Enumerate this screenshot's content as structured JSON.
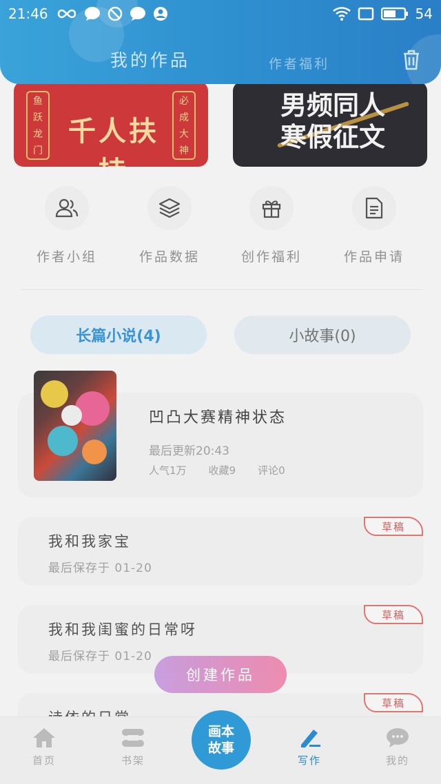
{
  "status_bar": {
    "time": "21:46",
    "battery": "54"
  },
  "header": {
    "tab_mine": "我的作品",
    "tab_welfare": "作者福利"
  },
  "banners": {
    "left": {
      "text": "千人扶持",
      "side_left": [
        "鱼",
        "跃",
        "龙",
        "门"
      ],
      "side_right": [
        "必",
        "成",
        "大",
        "神"
      ]
    },
    "right": {
      "line1": "男频同人",
      "line2": "寒假征文"
    }
  },
  "quick_actions": [
    {
      "label": "作者小组",
      "icon": "users-icon"
    },
    {
      "label": "作品数据",
      "icon": "layers-icon"
    },
    {
      "label": "创作福利",
      "icon": "gift-icon"
    },
    {
      "label": "作品申请",
      "icon": "document-icon"
    }
  ],
  "segments": {
    "long": "长篇小说(4)",
    "short": "小故事(0)"
  },
  "novel": {
    "title": "凹凸大赛精神状态",
    "updated": "最后更新20:43",
    "popularity": "人气1万",
    "favorites": "收藏9",
    "comments": "评论0"
  },
  "drafts": [
    {
      "title": "我和我家宝",
      "date": "最后保存于 01-20",
      "badge": "草稿"
    },
    {
      "title": "我和我闺蜜的日常呀",
      "date": "最后保存于 01-20",
      "badge": "草稿"
    },
    {
      "title": "诗依的日常",
      "date": "",
      "badge": "草稿"
    }
  ],
  "create_button": "创建作品",
  "bottom_nav": {
    "home": "首页",
    "shelf": "书架",
    "center": "画本故事",
    "write": "写作",
    "me": "我的"
  },
  "colors": {
    "accent": "#2a8bd0",
    "header": "#2e8fcf",
    "draft_red": "#d9534f"
  }
}
